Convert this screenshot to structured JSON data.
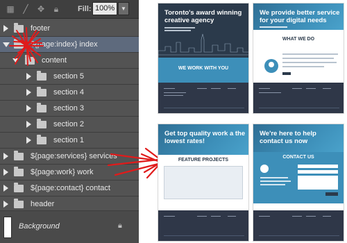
{
  "layers_panel": {
    "toolbar": {
      "icons": [
        "transparency-lock-icon",
        "paint-brush-icon",
        "move-icon",
        "lock-icon"
      ],
      "fill_label": "Fill:",
      "fill_value": "100%"
    },
    "layers": [
      {
        "label": "footer",
        "expanded": false,
        "selected": false
      },
      {
        "label": "${page:index} index",
        "expanded": true,
        "selected": true
      },
      {
        "label": "content",
        "expanded": true,
        "selected": false
      },
      {
        "label": "section 5",
        "expanded": false,
        "selected": false
      },
      {
        "label": "section 4",
        "expanded": false,
        "selected": false
      },
      {
        "label": "section 3",
        "expanded": false,
        "selected": false
      },
      {
        "label": "section 2",
        "expanded": false,
        "selected": false
      },
      {
        "label": "section 1",
        "expanded": false,
        "selected": false
      },
      {
        "label": "${page:services} services",
        "expanded": false,
        "selected": false
      },
      {
        "label": "${page:work} work",
        "expanded": false,
        "selected": false
      },
      {
        "label": "${page:contact} contact",
        "expanded": false,
        "selected": false
      },
      {
        "label": "header",
        "expanded": false,
        "selected": false
      }
    ],
    "background_layer": {
      "label": "Background",
      "locked": true
    },
    "annotation_color": "#e01b1b"
  },
  "previews": [
    {
      "page": "index",
      "hero_title": "Toronto's award winning creative agency",
      "band_title": "WE WORK WITH YOU"
    },
    {
      "page": "services",
      "hero_title": "We provide better service for your digital needs",
      "section_title": "WHAT WE DO"
    },
    {
      "page": "work",
      "hero_title": "Get top quality work a the lowest rates!",
      "section_title": "FEATURE PROJECTS"
    },
    {
      "page": "contact",
      "hero_title": "We're here to help contact us now",
      "section_title": "CONTACT US"
    }
  ],
  "colors": {
    "dark_navy": "#2b3a4b",
    "accent_blue": "#3d8fb9",
    "footer": "#2f3748"
  }
}
